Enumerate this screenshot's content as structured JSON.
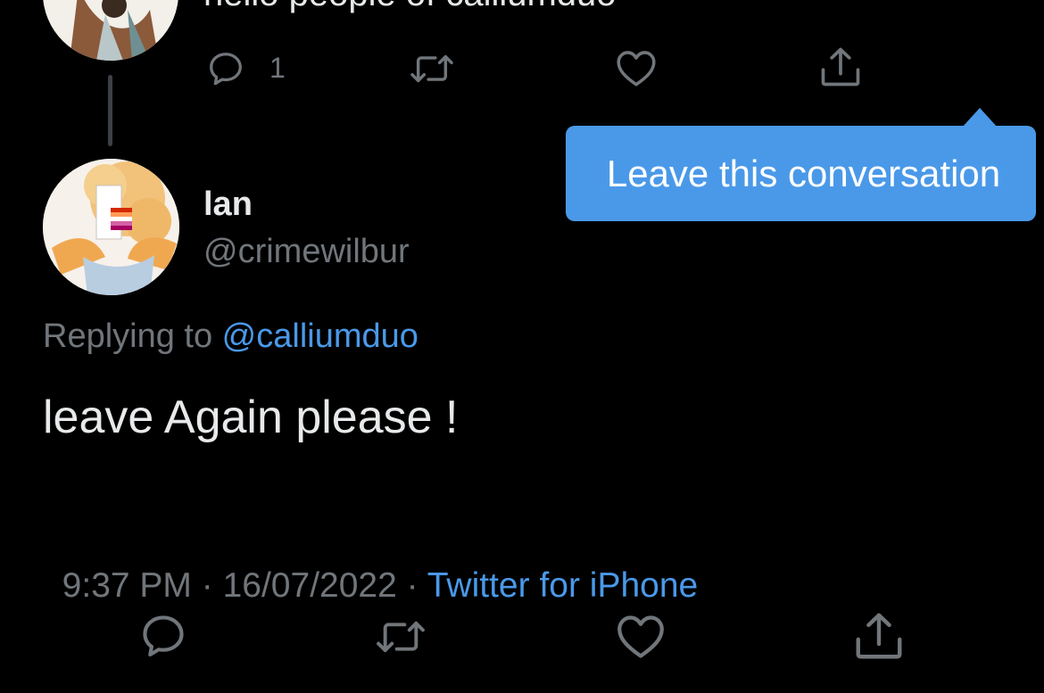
{
  "prev_tweet": {
    "text": "hello people of calliumduo",
    "reply_count": "1",
    "icons": [
      "reply-icon",
      "retweet-icon",
      "like-icon",
      "share-icon"
    ]
  },
  "tooltip": {
    "label": "Leave this conversation"
  },
  "tweet": {
    "display_name": "lan",
    "handle": "@crimewilbur",
    "replying_prefix": "Replying to ",
    "replying_handle": "@calliumduo",
    "text": "leave Again please !",
    "time": "9:37 PM",
    "sep1": " · ",
    "date": "16/07/2022",
    "sep2": " · ",
    "source": "Twitter for iPhone"
  },
  "colors": {
    "background": "#000000",
    "accent": "#4a99e9",
    "muted": "#71767b",
    "text": "#e7e9ea"
  }
}
